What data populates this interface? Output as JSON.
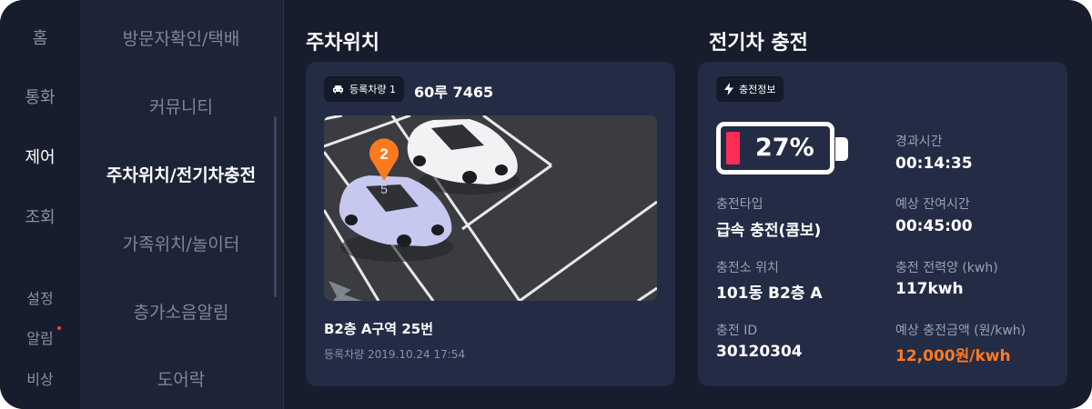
{
  "nav": {
    "items": [
      {
        "label": "홈",
        "active": false
      },
      {
        "label": "통화",
        "active": false
      },
      {
        "label": "제어",
        "active": true
      },
      {
        "label": "조회",
        "active": false
      }
    ],
    "bottom": [
      {
        "label": "설정"
      },
      {
        "label": "알림",
        "badge": true
      },
      {
        "label": "비상"
      }
    ]
  },
  "submenu": {
    "items": [
      {
        "label": "방문자확인/택배",
        "active": false
      },
      {
        "label": "커뮤니티",
        "active": false
      },
      {
        "label": "주차위치/전기차충전",
        "active": true
      },
      {
        "label": "가족위치/놀이터",
        "active": false
      },
      {
        "label": "층가소음알림",
        "active": false
      },
      {
        "label": "도어락",
        "active": false
      }
    ]
  },
  "parking": {
    "title": "주차위치",
    "chip_label": "등록차량 1",
    "plate": "60루 7465",
    "marker_number": "2",
    "spot_number": "5",
    "location": "B2층 A구역 25번",
    "registered": "등록차량 2019.10.24 17:54"
  },
  "charging": {
    "title": "전기차 충전",
    "chip_label": "충전정보",
    "battery_percent": "27%",
    "battery_level": 0.27,
    "fields": {
      "type_label": "충전타입",
      "type_value": "급속 충전(콤보)",
      "station_label": "충전소 위치",
      "station_value": "101동 B2층 A",
      "id_label": "충전 ID",
      "id_value": "30120304",
      "elapsed_label": "경과시간",
      "elapsed_value": "00:14:35",
      "remaining_label": "예상 잔여시간",
      "remaining_value": "00:45:00",
      "energy_label": "충전 전력양 (kwh)",
      "energy_value": "117kwh",
      "cost_label": "예상 충전금액 (원/kwh)",
      "cost_value": "12,000원/kwh"
    }
  },
  "colors": {
    "background": "#181d2e",
    "card": "#242c45",
    "accent_orange": "#ff7a1f",
    "battery_red": "#ff2d55",
    "badge_red": "#ff3b54"
  }
}
